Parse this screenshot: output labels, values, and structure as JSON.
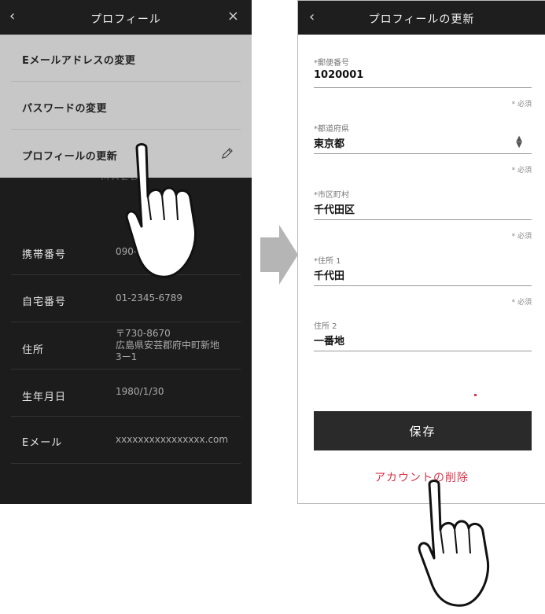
{
  "left_screen": {
    "header": {
      "back_icon": "‹",
      "title": "プロフィール",
      "close_icon": "×"
    },
    "menu": {
      "items": [
        {
          "label": "Eメールアドレスの変更"
        },
        {
          "label": "パスワードの変更"
        },
        {
          "label": "プロフィールの更新",
          "icon": "pencil-icon"
        }
      ]
    },
    "logo_text": "MAZD",
    "profile_rows": [
      {
        "key": "携帯番号",
        "value": "090-"
      },
      {
        "key": "自宅番号",
        "value": "01-2345-6789"
      },
      {
        "key": "住所",
        "value_lines": [
          "〒730-8670",
          "広島県安芸郡府中町新地",
          "3ー1"
        ]
      },
      {
        "key": "生年月日",
        "value": "1980/1/30"
      },
      {
        "key": "Eメール",
        "value": "xxxxxxxxxxxxxxxx.com"
      }
    ]
  },
  "right_screen": {
    "header": {
      "back_icon": "‹",
      "title": "プロフィールの更新"
    },
    "fields": [
      {
        "label": "*郵便番号",
        "value": "1020001",
        "required_note": "* 必須"
      },
      {
        "label": "*都道府県",
        "value": "東京都",
        "required_note": "* 必須",
        "select": true
      },
      {
        "label": "*市区町村",
        "value": "千代田区",
        "required_note": "* 必須"
      },
      {
        "label": "*住所 1",
        "value": "千代田",
        "required_note": "* 必須"
      },
      {
        "label": "住所 2",
        "value": "一番地"
      }
    ],
    "save_label": "保存",
    "delete_label": "アカウントの削除"
  },
  "colors": {
    "dark_bg": "#1c1c1c",
    "menu_bg": "#c7c7c7",
    "arrow": "#b5b5b5",
    "button": "#2a2a2a",
    "delete_text": "#d9334a"
  }
}
